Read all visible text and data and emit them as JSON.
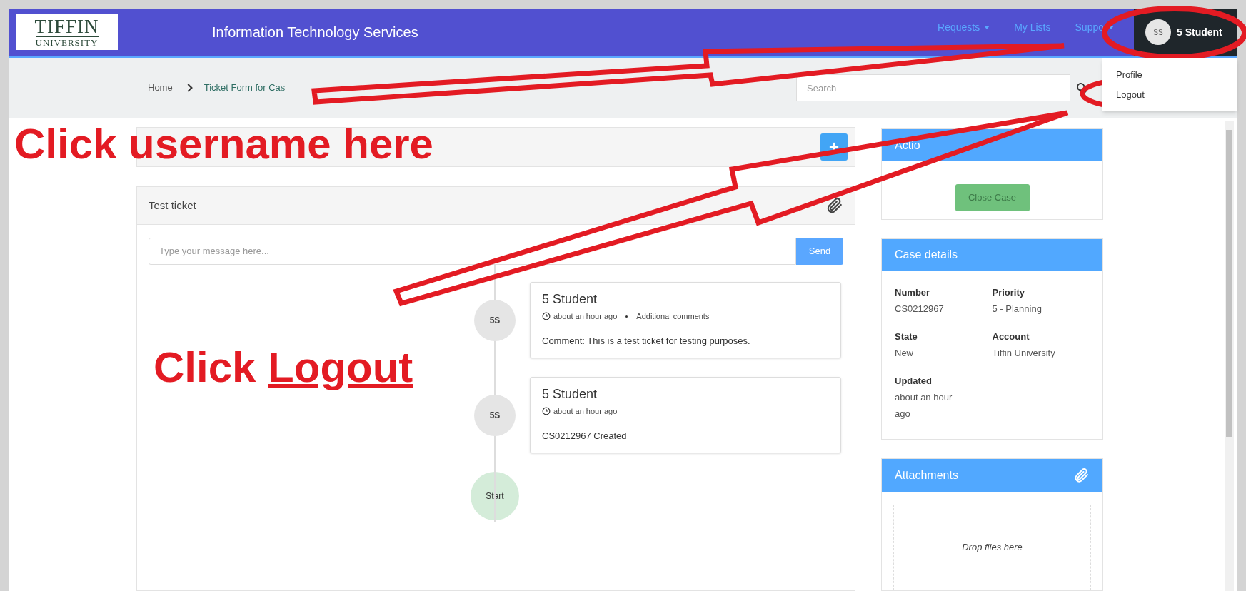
{
  "navbar": {
    "logo": {
      "line1": "TIFFIN",
      "line2": "UNIVERSITY"
    },
    "title": "Information Technology Services",
    "menu": [
      {
        "label": "Requests",
        "dropdown": true
      },
      {
        "label": "My Lists",
        "dropdown": false
      },
      {
        "label": "Suppo",
        "dropdown": true
      }
    ],
    "user": {
      "initials": "SS",
      "name": "5 Student"
    }
  },
  "user_menu": [
    {
      "label": "Profile"
    },
    {
      "label": "Logout"
    }
  ],
  "breadcrumb": [
    "Home",
    "Ticket Form for Cas"
  ],
  "search": {
    "placeholder": "Search"
  },
  "ticket": {
    "title": "Test ticket",
    "message": {
      "placeholder": "Type your message here...",
      "send": "Send"
    },
    "entries": [
      {
        "initials": "5S",
        "author": "5 Student",
        "time": "about an hour ago",
        "type": "Additional comments",
        "text": "Comment: This is a test ticket for testing purposes."
      },
      {
        "initials": "5S",
        "author": "5 Student",
        "time": "about an hour ago",
        "text": "CS0212967 Created"
      }
    ],
    "start": "Start"
  },
  "actions": {
    "title": "Actio",
    "button": "Close Case"
  },
  "case_details": {
    "title": "Case details",
    "fields": [
      {
        "label": "Number",
        "value": "CS0212967"
      },
      {
        "label": "Priority",
        "value": "5 - Planning"
      },
      {
        "label": "State",
        "value": "New"
      },
      {
        "label": "Account",
        "value": "Tiffin University"
      },
      {
        "label": "Updated",
        "value": "about an hour ago"
      }
    ]
  },
  "attachments": {
    "title": "Attachments",
    "drop": "Drop files here"
  },
  "annotations": [
    {
      "text": "Click username here"
    },
    {
      "text": "Click ",
      "link": "Logout"
    }
  ]
}
